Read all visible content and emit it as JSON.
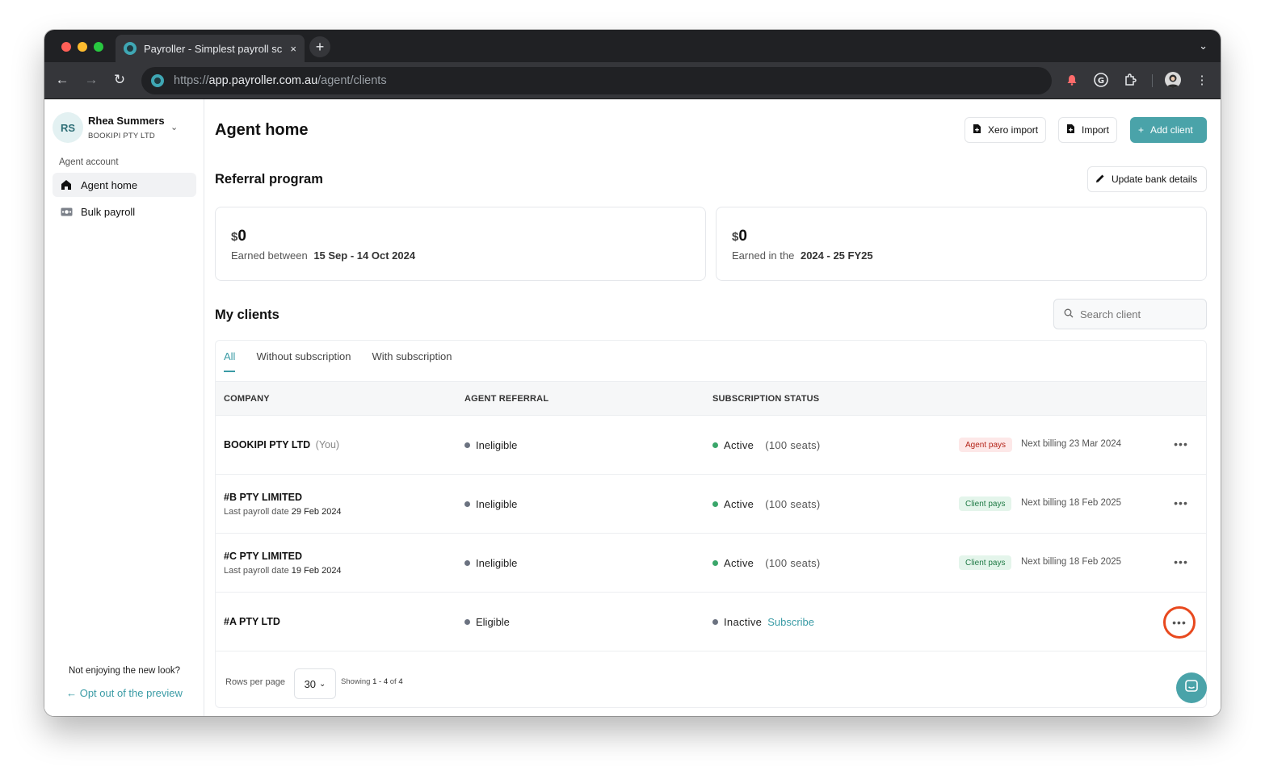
{
  "browser": {
    "tab_title": "Payroller - Simplest payroll sc",
    "tab_close": "×",
    "new_tab": "+",
    "url_scheme": "https://",
    "url_host": "app.payroller.com.au",
    "url_path": "/agent/clients",
    "icons": [
      "back-arrow-icon",
      "forward-arrow-icon",
      "reload-icon",
      "notification-extension-icon",
      "grammarly-icon",
      "extensions-puzzle-icon",
      "profile-avatar-icon",
      "kebab-menu-icon"
    ]
  },
  "sidebar": {
    "avatar_initials": "RS",
    "user_name": "Rhea Summers",
    "company": "BOOKIPI PTY LTD",
    "section_label": "Agent account",
    "items": [
      {
        "label": "Agent home",
        "icon": "home-icon"
      },
      {
        "label": "Bulk payroll",
        "icon": "money-icon"
      }
    ],
    "not_enjoying": "Not enjoying the new look?",
    "opt_out": "Opt out of the preview"
  },
  "header": {
    "title": "Agent home",
    "xero_import": "Xero import",
    "import": "Import",
    "add_client": "Add client"
  },
  "referral": {
    "title": "Referral program",
    "update_bank": "Update bank details",
    "cards": [
      {
        "currency": "$",
        "amount": "0",
        "earned_prefix": "Earned between",
        "period": "15 Sep - 14 Oct  2024"
      },
      {
        "currency": "$",
        "amount": "0",
        "earned_prefix": "Earned in the",
        "period": "2024 - 25  FY25"
      }
    ]
  },
  "clients": {
    "title": "My clients",
    "search_placeholder": "Search client",
    "tabs": [
      "All",
      "Without subscription",
      "With subscription"
    ],
    "active_tab": "All",
    "columns": {
      "company": "COMPANY",
      "referral": "AGENT REFERRAL",
      "status": "SUBSCRIPTION STATUS"
    },
    "rows": [
      {
        "company": "BOOKIPI PTY LTD",
        "you": "(You)",
        "last_payroll_label": "",
        "last_payroll_date": "",
        "referral": "Ineligible",
        "status": "Active",
        "seats": "(100 seats)",
        "badge": "Agent pays",
        "billing": "Next billing 23 Mar 2024"
      },
      {
        "company": "#B PTY LIMITED",
        "you": "",
        "last_payroll_label": "Last payroll date",
        "last_payroll_date": "29 Feb 2024",
        "referral": "Ineligible",
        "status": "Active",
        "seats": "(100 seats)",
        "badge": "Client pays",
        "billing": "Next billing 18 Feb 2025"
      },
      {
        "company": "#C PTY LIMITED",
        "you": "",
        "last_payroll_label": "Last payroll date",
        "last_payroll_date": "19 Feb 2024",
        "referral": "Ineligible",
        "status": "Active",
        "seats": "(100 seats)",
        "badge": "Client pays",
        "billing": "Next billing 18 Feb 2025"
      },
      {
        "company": "#A PTY LTD",
        "you": "",
        "last_payroll_label": "",
        "last_payroll_date": "",
        "referral": "Eligible",
        "status": "Inactive",
        "subscribe": "Subscribe",
        "badge": "",
        "billing": ""
      }
    ],
    "pagination": {
      "rows_per_page_label": "Rows per page",
      "rows_per_page": "30",
      "showing_label": "Showing",
      "range": "1 - 4",
      "of_label": "of",
      "total": "4"
    }
  },
  "colors": {
    "accent": "#4aa3a9",
    "active_dot": "#3aa66a",
    "highlight_ring": "#e8491e"
  }
}
